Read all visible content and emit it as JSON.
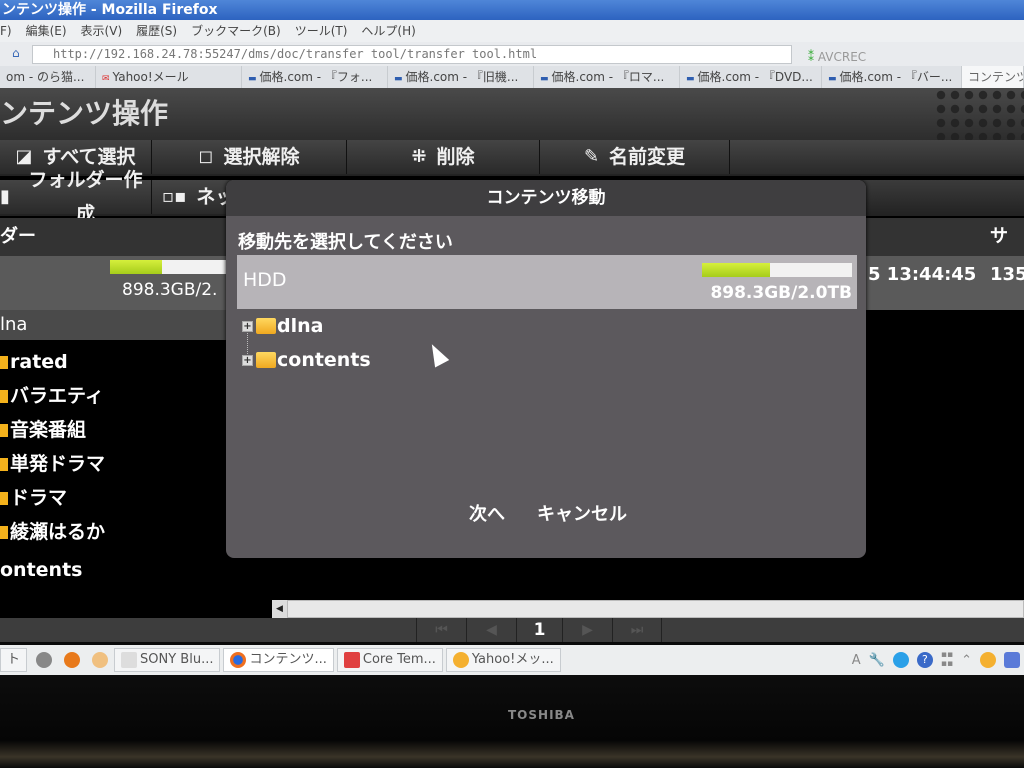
{
  "window": {
    "title": "ンテンツ操作 - Mozilla Firefox"
  },
  "menubar": {
    "items": [
      "F)",
      "編集(E)",
      "表示(V)",
      "履歴(S)",
      "ブックマーク(B)",
      "ツール(T)",
      "ヘルプ(H)"
    ]
  },
  "navbar": {
    "url": "http://192.168.24.78:55247/dms/doc/transfer tool/transfer tool.html",
    "search_engine": "AVCREC"
  },
  "tabs": [
    {
      "label": "om - のら猫..."
    },
    {
      "label": "Yahoo!メール"
    },
    {
      "label": "価格.com - 『フォ..."
    },
    {
      "label": "価格.com - 『旧機..."
    },
    {
      "label": "価格.com - 『ロマ..."
    },
    {
      "label": "価格.com - 『DVD..."
    },
    {
      "label": "価格.com - 『バー..."
    },
    {
      "label": "コンテンツ",
      "active": true
    }
  ],
  "app": {
    "title": "ンテンツ操作",
    "toolbar_row1": [
      {
        "label": "すべて選択",
        "icon": "checkbox-icon"
      },
      {
        "label": "選択解除",
        "icon": "square-icon"
      },
      {
        "label": "削除",
        "icon": "burst-icon"
      },
      {
        "label": "名前変更",
        "icon": "pencil-icon"
      }
    ],
    "toolbar_row2": [
      {
        "label": "フォルダー作成",
        "icon": "folder-icon"
      },
      {
        "label": "ネッ",
        "icon": "network-icon"
      }
    ],
    "list_header": {
      "folder_col": "ダー",
      "size_col": "サイ"
    },
    "drive": {
      "capacity": "898.3GB/2.",
      "usage_fraction": 0.45
    },
    "row": {
      "datetime": "5 13:44:45",
      "size": "135"
    },
    "tree": {
      "root": "lna",
      "items": [
        "rated",
        "バラエティ",
        "音楽番組",
        "単発ドラマ",
        "ドラマ",
        "綾瀬はるか"
      ],
      "second_root": "ontents"
    },
    "pager": {
      "current_page": "1"
    }
  },
  "dialog": {
    "title": "コンテンツ移動",
    "prompt": "移動先を選択してください",
    "drive": {
      "label": "HDD",
      "capacity": "898.3GB/2.0TB",
      "usage_fraction": 0.45
    },
    "folders": [
      {
        "name": "dlna"
      },
      {
        "name": "contents"
      }
    ],
    "next_label": "次へ",
    "cancel_label": "キャンセル"
  },
  "taskbar": {
    "start_fragment": "ト",
    "windows": [
      {
        "label": "SONY Blu..."
      },
      {
        "label": "コンテンツ...",
        "active": true
      },
      {
        "label": "Core Tem..."
      },
      {
        "label": "Yahoo!メッ..."
      }
    ]
  },
  "monitor": {
    "brand": "TOSHIBA"
  }
}
